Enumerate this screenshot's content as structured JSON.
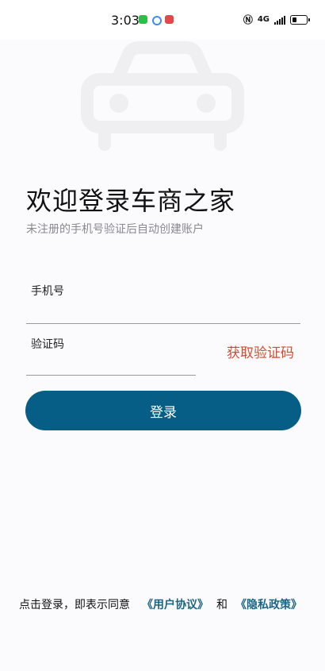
{
  "status_bar": {
    "time": "3:03",
    "network": "4G",
    "app_icons": [
      "wechat-icon",
      "blue-app-icon",
      "red-app-icon"
    ],
    "colors": {
      "wechat": "#2bbf4a",
      "blue_app": "#3b8ff0",
      "red_app": "#e04a4a"
    }
  },
  "header": {
    "title": "欢迎登录车商之家",
    "subtitle": "未注册的手机号验证后自动创建账户"
  },
  "form": {
    "phone_label": "手机号",
    "code_label": "验证码",
    "get_code_label": "获取验证码",
    "login_label": "登录"
  },
  "agreement": {
    "prefix": "点击登录，即表示同意",
    "user_agreement": "《用户协议》",
    "and": "和",
    "privacy_policy": "《隐私政策》"
  },
  "colors": {
    "primary": "#065e86",
    "get_code": "#d54a2b",
    "link": "#1d6585"
  }
}
